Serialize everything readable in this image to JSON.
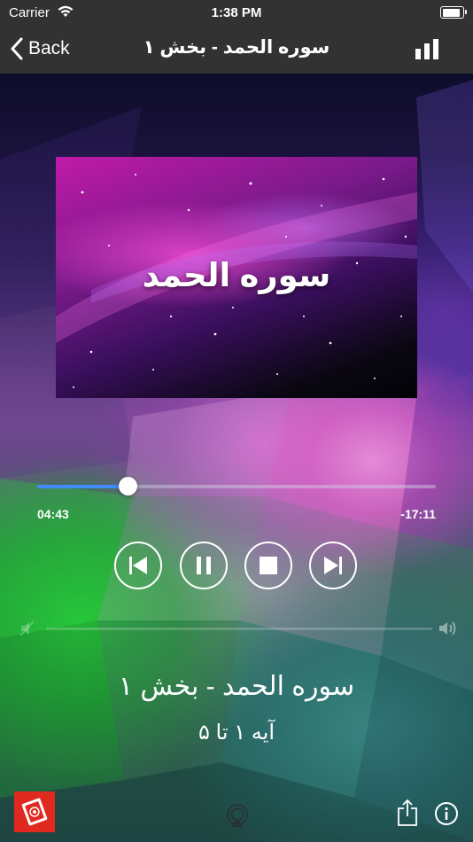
{
  "status_bar": {
    "carrier": "Carrier",
    "time": "1:38 PM",
    "battery_level": 1.0
  },
  "nav": {
    "back_label": "Back",
    "title": "سوره الحمد - بخش ۱",
    "right_icon": "bar-chart-icon"
  },
  "artwork": {
    "title": "سوره الحمد"
  },
  "player": {
    "elapsed": "04:43",
    "remaining": "-17:11",
    "progress_fraction": 0.227,
    "controls": [
      "previous-icon",
      "pause-icon",
      "stop-icon",
      "next-icon"
    ],
    "accent_color": "#3f8bff"
  },
  "track": {
    "title": "سوره الحمد - بخش ۱",
    "subtitle": "آیه ۱ تا ۵"
  },
  "toolbar": {
    "icons": [
      "quran-book-icon",
      "airplay-icon",
      "share-icon",
      "info-icon"
    ]
  }
}
